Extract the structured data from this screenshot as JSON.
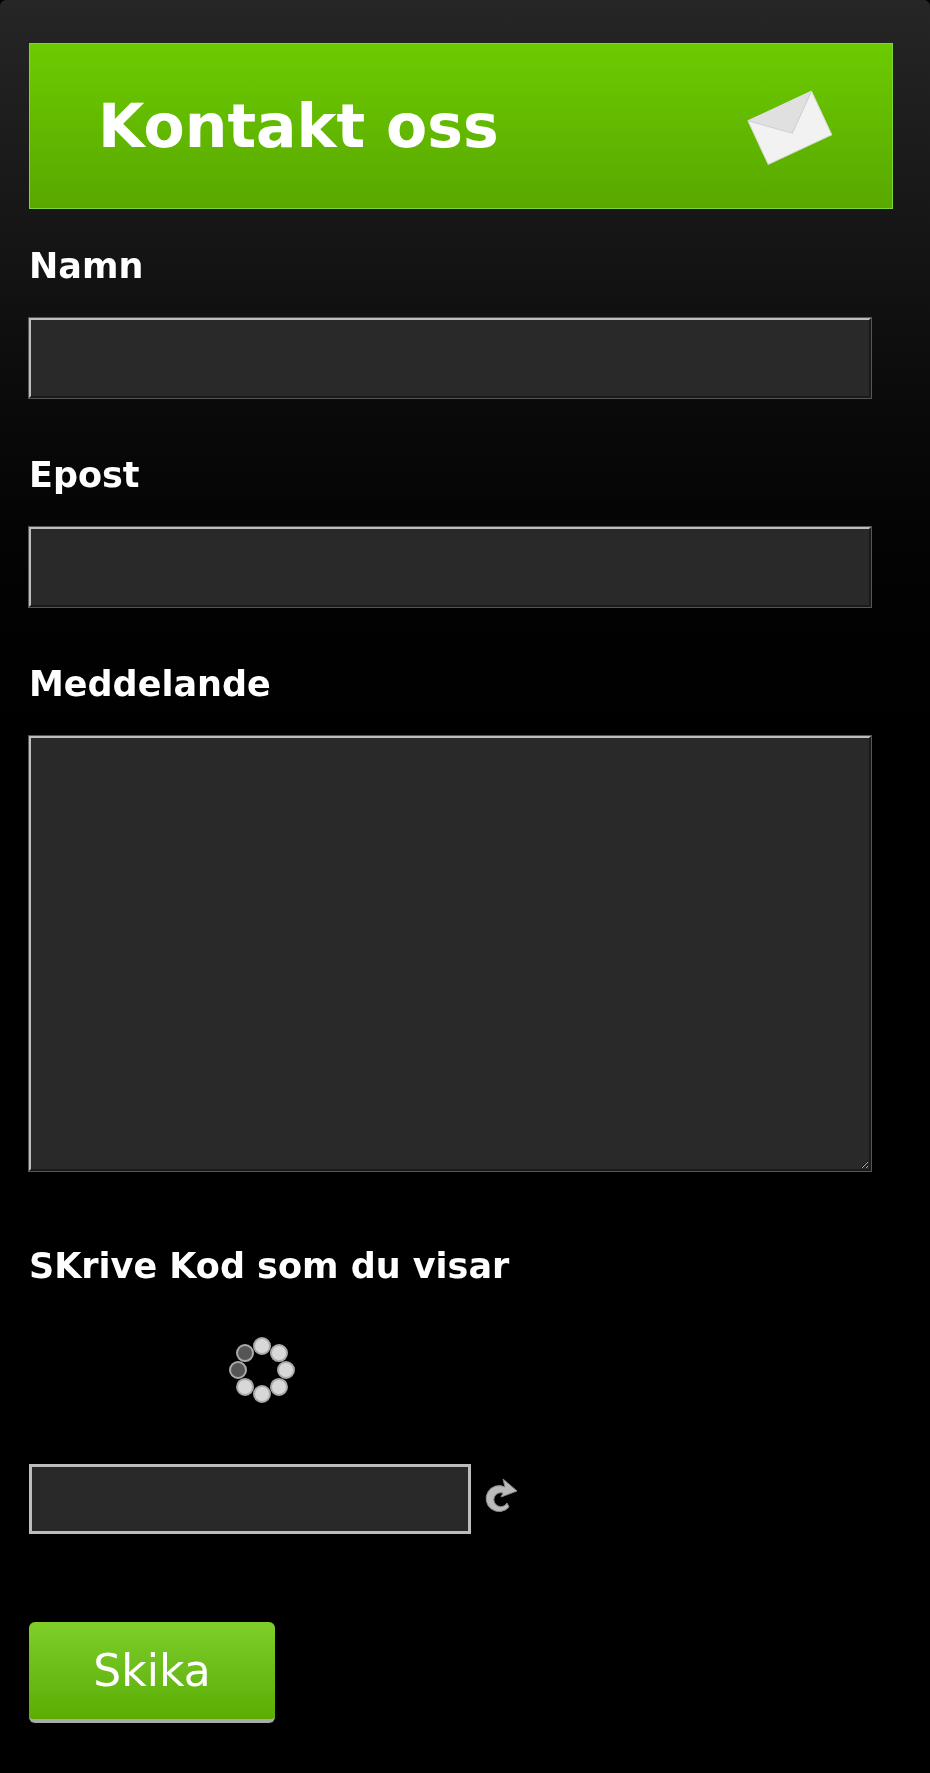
{
  "header": {
    "title": "Kontakt oss"
  },
  "fields": [
    {
      "label": "Namn",
      "kind": "input"
    },
    {
      "label": "Epost",
      "kind": "input"
    },
    {
      "label": "Meddelande",
      "kind": "textarea"
    }
  ],
  "captcha": {
    "label": "SKrive Kod som du visar"
  },
  "submit": {
    "label": "Skika"
  }
}
